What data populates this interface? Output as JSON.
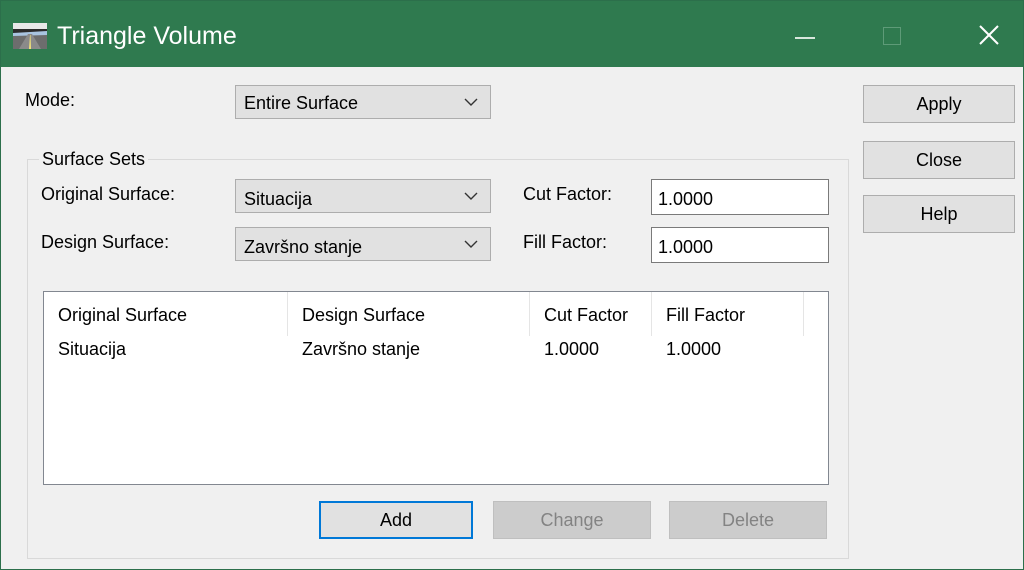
{
  "window": {
    "title": "Triangle Volume"
  },
  "mode": {
    "label": "Mode:",
    "value": "Entire Surface"
  },
  "actions": {
    "apply": "Apply",
    "close": "Close",
    "help": "Help"
  },
  "surface_sets": {
    "group_label": "Surface Sets",
    "original_label": "Original Surface:",
    "original_value": "Situacija",
    "design_label": "Design Surface:",
    "design_value": "Završno stanje",
    "cut_label": "Cut Factor:",
    "cut_value": "1.0000",
    "fill_label": "Fill Factor:",
    "fill_value": "1.0000"
  },
  "table": {
    "columns": [
      "Original Surface",
      "Design Surface",
      "Cut Factor",
      "Fill Factor"
    ],
    "rows": [
      [
        "Situacija",
        "Završno stanje",
        "1.0000",
        "1.0000"
      ]
    ]
  },
  "list_buttons": {
    "add": "Add",
    "change": "Change",
    "delete": "Delete"
  },
  "colors": {
    "titlebar": "#2f7a4f",
    "focus_border": "#0078d7"
  },
  "icons": {
    "app": "road-image-icon",
    "minimize": "minimize-icon",
    "maximize": "maximize-icon",
    "close": "close-icon",
    "dropdown": "chevron-down-icon"
  }
}
